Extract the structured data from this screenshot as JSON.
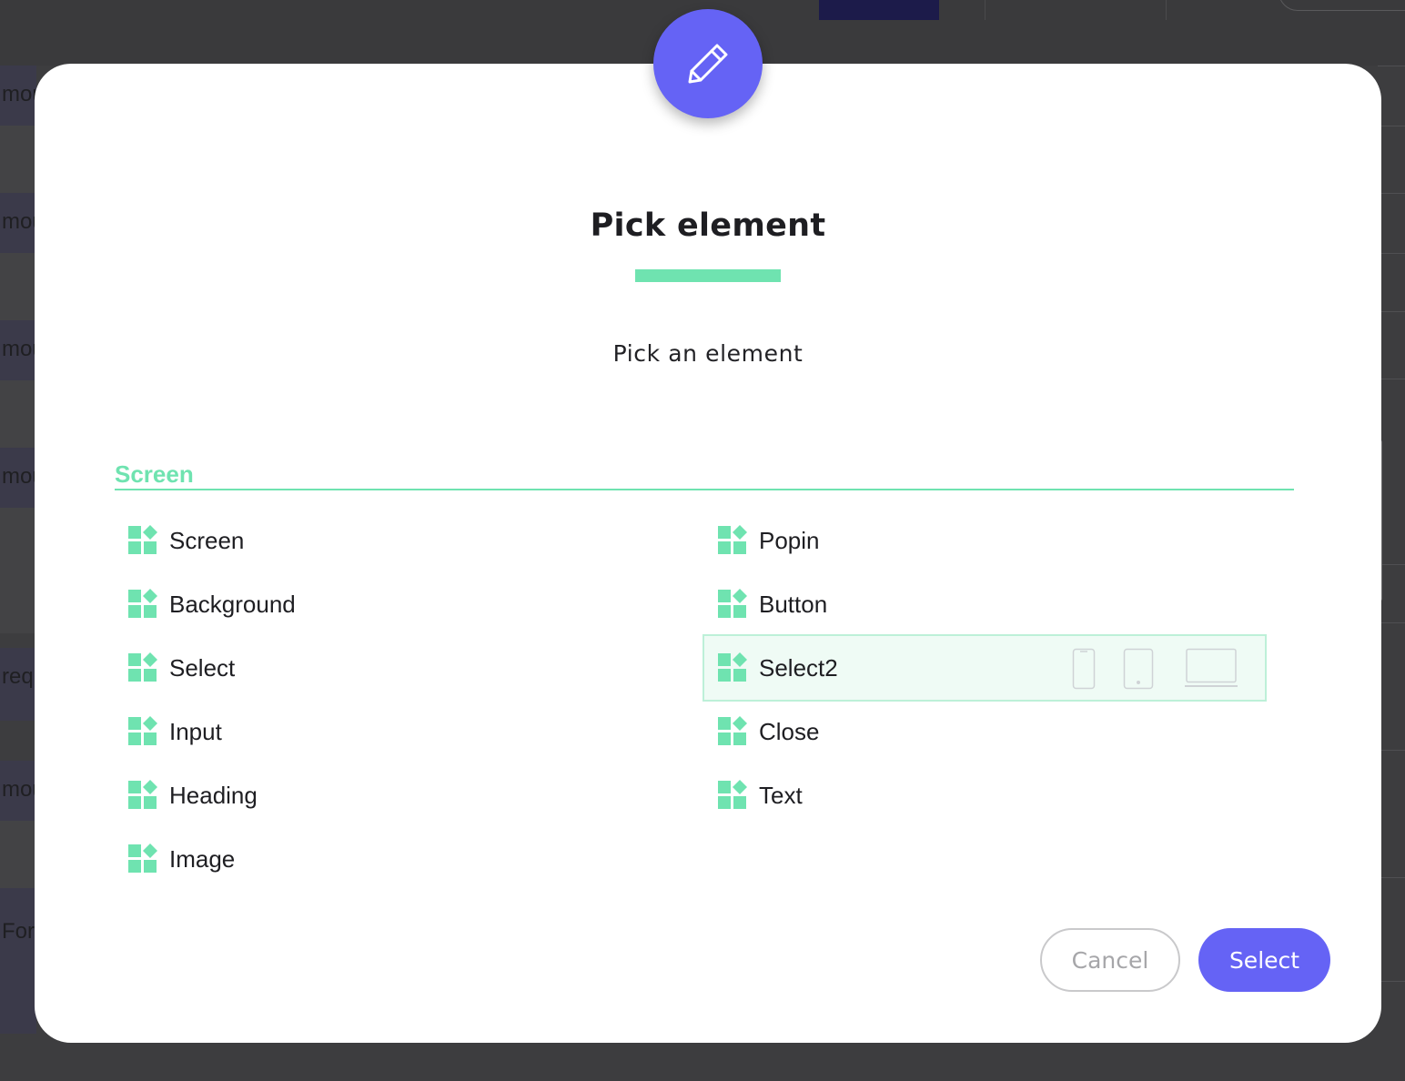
{
  "background": {
    "row_labels": [
      "mou",
      "mou",
      "mou",
      "mou",
      "requ",
      "mou",
      "Forr"
    ]
  },
  "modal": {
    "badge_icon": "pencil-icon",
    "title": "Pick element",
    "subtitle": "Pick an element",
    "accent_color": "#6fe3b0",
    "primary_color": "#6563f5",
    "section": {
      "title": "Screen",
      "items_left": [
        {
          "label": "Screen",
          "icon": "widgets-icon"
        },
        {
          "label": "Background",
          "icon": "widgets-icon"
        },
        {
          "label": "Select",
          "icon": "widgets-icon"
        },
        {
          "label": "Input",
          "icon": "widgets-icon"
        },
        {
          "label": "Heading",
          "icon": "widgets-icon"
        },
        {
          "label": "Image",
          "icon": "widgets-icon"
        }
      ],
      "items_right": [
        {
          "label": "Popin",
          "icon": "widgets-icon"
        },
        {
          "label": "Button",
          "icon": "widgets-icon"
        },
        {
          "label": "Select2",
          "icon": "widgets-icon",
          "selected": true,
          "devices": [
            "phone-icon",
            "tablet-icon",
            "laptop-icon"
          ]
        },
        {
          "label": "Close",
          "icon": "widgets-icon"
        },
        {
          "label": "Text",
          "icon": "widgets-icon"
        }
      ]
    },
    "cancel_label": "Cancel",
    "select_label": "Select"
  }
}
